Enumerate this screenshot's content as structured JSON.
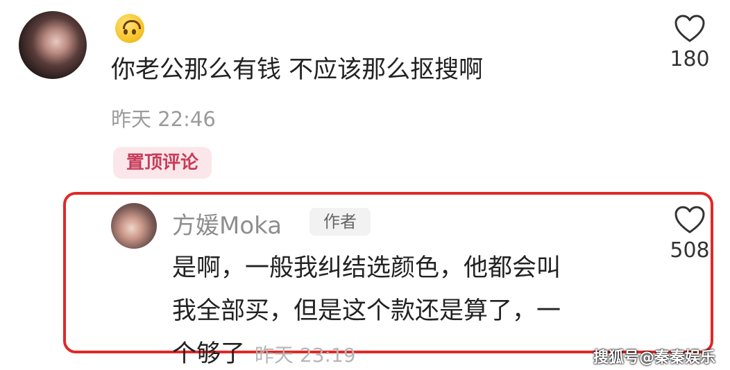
{
  "main_comment": {
    "emoji": "upside-down-face",
    "text": "你老公那么有钱 不应该那么抠搜啊",
    "time": "昨天 22:46",
    "pin_label": "置顶评论",
    "likes": "180"
  },
  "reply": {
    "username": "方媛Moka",
    "author_tag": "作者",
    "lines": [
      "是啊，一般我纠结选颜色，他都会叫",
      "我全部买，但是这个款还是算了，一",
      "个够了"
    ],
    "time": "昨天 23:19",
    "likes": "508"
  },
  "watermark": "搜狐号@秦秦娱乐",
  "colors": {
    "highlight_border": "#e02828",
    "pin_badge_bg": "#fbe7ea",
    "pin_badge_text": "#c73c5a"
  }
}
